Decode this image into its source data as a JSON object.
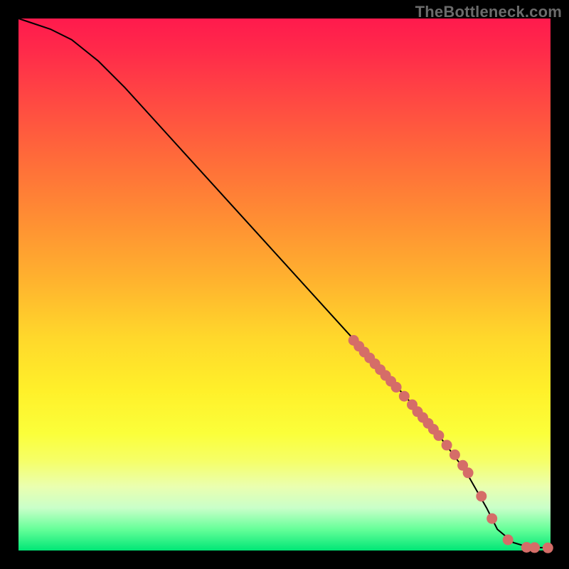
{
  "watermark": "TheBottleneck.com",
  "colors": {
    "frame": "#000000",
    "curve": "#000000",
    "dots": "#d56d68"
  },
  "chart_data": {
    "type": "line",
    "title": "",
    "xlabel": "",
    "ylabel": "",
    "xlim": [
      0,
      100
    ],
    "ylim": [
      0,
      100
    ],
    "series": [
      {
        "name": "bottleneck-curve",
        "x": [
          0,
          3,
          6,
          10,
          15,
          20,
          30,
          40,
          50,
          60,
          70,
          78,
          84,
          88,
          90,
          93,
          96,
          100
        ],
        "y": [
          100,
          99,
          98,
          96,
          92,
          87,
          76,
          65,
          54,
          43,
          32,
          23,
          15,
          8,
          4,
          1.5,
          0.6,
          0.5
        ]
      }
    ],
    "highlight_points": {
      "name": "highlighted-samples",
      "x": [
        63,
        64,
        65,
        66,
        67,
        68,
        69,
        70,
        71,
        72.5,
        74,
        75,
        76,
        77,
        78,
        79,
        80.5,
        82,
        83.5,
        84.5,
        87,
        89,
        92,
        95.5,
        97,
        99.5
      ],
      "y": [
        39.5,
        38.4,
        37.3,
        36.2,
        35.1,
        34.0,
        32.9,
        31.8,
        30.7,
        29.0,
        27.4,
        26.1,
        25.0,
        23.9,
        22.8,
        21.6,
        19.8,
        18.0,
        16.0,
        14.6,
        10.2,
        6.0,
        2.0,
        0.6,
        0.55,
        0.5
      ]
    }
  }
}
